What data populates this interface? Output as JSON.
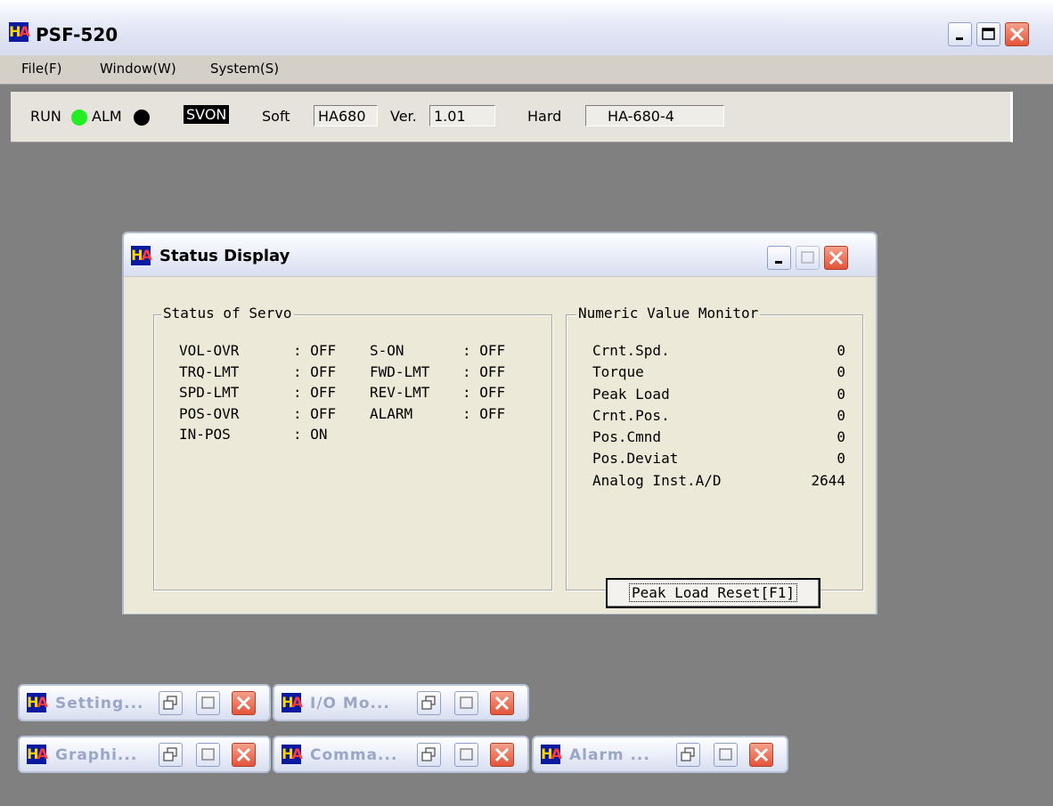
{
  "main": {
    "title": "PSF-520",
    "logo": "HA",
    "menu": [
      "File(F)",
      "Window(W)",
      "System(S)"
    ]
  },
  "toolbar": {
    "run_label": "RUN",
    "run_led_color": "#22ee22",
    "alm_label": "ALM",
    "alm_led_color": "#000000",
    "svon_label": "SVON",
    "soft_label": "Soft",
    "soft_value": "HA680",
    "ver_label": "Ver.",
    "ver_value": "1.01",
    "hard_label": "Hard",
    "hard_value": "HA-680-4"
  },
  "status_window": {
    "title": "Status Display",
    "servo_group": {
      "legend": "Status of Servo",
      "rows": [
        {
          "name": "VOL-OVR",
          "value": ": OFF",
          "name2": "S-ON",
          "value2": ": OFF"
        },
        {
          "name": "TRQ-LMT",
          "value": ": OFF",
          "name2": "FWD-LMT",
          "value2": ": OFF"
        },
        {
          "name": "SPD-LMT",
          "value": ": OFF",
          "name2": "REV-LMT",
          "value2": ": OFF"
        },
        {
          "name": "POS-OVR",
          "value": ": OFF",
          "name2": "ALARM",
          "value2": ": OFF"
        },
        {
          "name": "IN-POS",
          "value": ": ON",
          "name2": "",
          "value2": ""
        }
      ]
    },
    "monitor_group": {
      "legend": "Numeric Value Monitor",
      "rows": [
        {
          "label": "Crnt.Spd.",
          "value": "0"
        },
        {
          "label": "Torque",
          "value": "0"
        },
        {
          "label": "Peak Load",
          "value": "0"
        },
        {
          "label": "Crnt.Pos.",
          "value": "0"
        },
        {
          "label": "Pos.Cmnd",
          "value": "0"
        },
        {
          "label": "Pos.Deviat",
          "value": "0"
        },
        {
          "label": "Analog Inst.A/D",
          "value": "2644"
        }
      ],
      "reset_button": "Peak Load Reset[F1]"
    }
  },
  "minimized": [
    "Setting...",
    "I/O Mo...",
    "Graphi...",
    "Comma...",
    "Alarm ..."
  ]
}
